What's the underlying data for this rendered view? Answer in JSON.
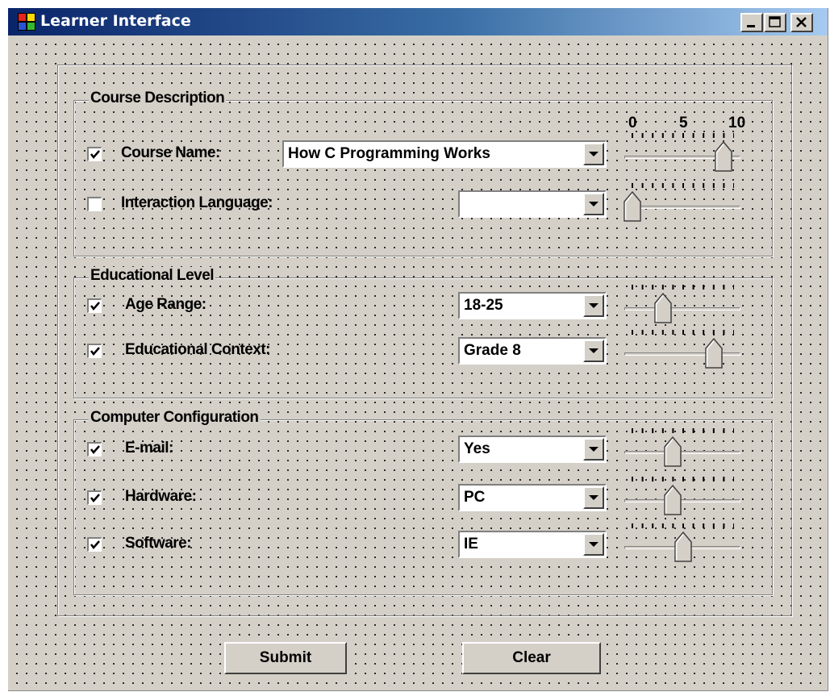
{
  "window": {
    "title": "Learner Interface"
  },
  "scale_labels": [
    "0",
    "5",
    "10"
  ],
  "groups": {
    "course": {
      "title": "Course Description",
      "rows": [
        {
          "label": "Course Name:",
          "checked": true,
          "value": "How C Programming Works",
          "slider": 9
        },
        {
          "label": "Interaction Language:",
          "checked": false,
          "value": "",
          "slider": 0
        }
      ]
    },
    "education": {
      "title": "Educational Level",
      "rows": [
        {
          "label": "Age Range:",
          "checked": true,
          "value": "18-25",
          "slider": 3
        },
        {
          "label": "Educational Context:",
          "checked": true,
          "value": "Grade 8",
          "slider": 8
        }
      ]
    },
    "computer": {
      "title": "Computer Configuration",
      "rows": [
        {
          "label": "E-mail:",
          "checked": true,
          "value": "Yes",
          "slider": 4
        },
        {
          "label": "Hardware:",
          "checked": true,
          "value": "PC",
          "slider": 4
        },
        {
          "label": "Software:",
          "checked": true,
          "value": "IE",
          "slider": 5
        }
      ]
    }
  },
  "buttons": {
    "submit": "Submit",
    "clear": "Clear"
  },
  "icons": {
    "app": "app-window-icon",
    "minimize": "minimize-icon",
    "maximize": "maximize-icon",
    "close": "close-icon",
    "dropdown": "dropdown-arrow-icon",
    "check": "checkmark-icon"
  },
  "colors": {
    "title_start": "#0a246a",
    "title_end": "#a6caf0",
    "face": "#d4d0c8"
  }
}
